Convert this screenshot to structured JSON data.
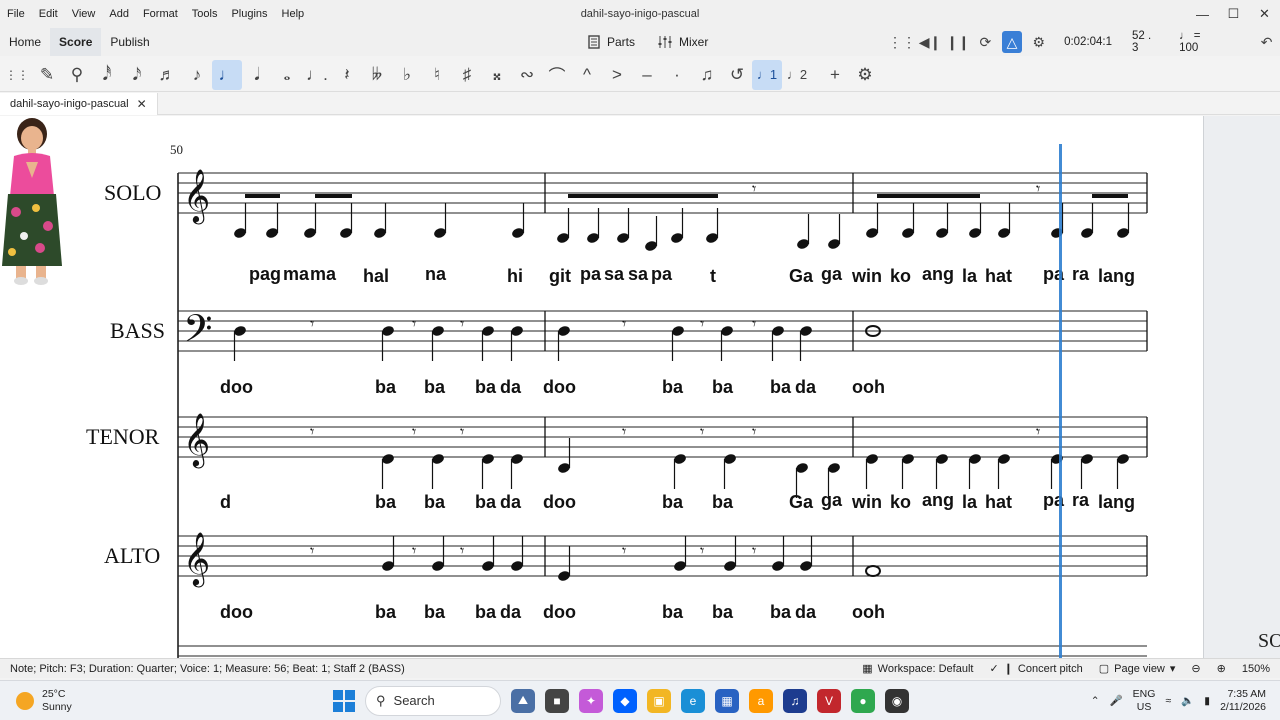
{
  "window": {
    "title": "dahil-sayo-inigo-pascual",
    "menu": [
      "File",
      "Edit",
      "View",
      "Add",
      "Format",
      "Tools",
      "Plugins",
      "Help"
    ]
  },
  "modes": {
    "tabs": [
      "Home",
      "Score",
      "Publish"
    ],
    "active": "Score",
    "parts_label": "Parts",
    "mixer_label": "Mixer",
    "time_readout": "0:02:04:1",
    "measure_beat": "52 . 3",
    "tempo_value": "= 100"
  },
  "note_toolbar": {
    "active": "quarter-note"
  },
  "document_tab": {
    "label": "dahil-sayo-inigo-pascual"
  },
  "score": {
    "measure_number": "50",
    "staves": [
      {
        "name": "SOLO",
        "lyrics": [
          "pag",
          "ma",
          "ma",
          "hal",
          "na",
          "hi",
          "git",
          "pa",
          "sa",
          "sa",
          "pa",
          "t",
          "Ga",
          "ga",
          "win",
          "ko",
          "ang",
          "la",
          "hat",
          "pa",
          "ra",
          "lang"
        ]
      },
      {
        "name": "BASS",
        "lyrics": [
          "doo",
          "ba",
          "ba",
          "ba",
          "da",
          "doo",
          "ba",
          "ba",
          "ba",
          "da",
          "ooh"
        ]
      },
      {
        "name": "TENOR",
        "lyrics": [
          "d",
          "ba",
          "ba",
          "ba",
          "da",
          "doo",
          "ba",
          "ba",
          "Ga",
          "ga",
          "win",
          "ko",
          "ang",
          "la",
          "hat",
          "pa",
          "ra",
          "lang"
        ]
      },
      {
        "name": "ALTO",
        "lyrics": [
          "doo",
          "ba",
          "ba",
          "ba",
          "da",
          "doo",
          "ba",
          "ba",
          "ba",
          "da",
          "ooh"
        ]
      }
    ],
    "edge_label": "SO"
  },
  "status": {
    "text": "Note; Pitch: F3; Duration: Quarter; Voice: 1; Measure: 56; Beat: 1; Staff 2 (BASS)",
    "workspace": "Workspace: Default",
    "concert_pitch": "Concert pitch",
    "page_view": "Page view",
    "zoom": "150%"
  },
  "taskbar": {
    "temperature": "25°C",
    "weather": "Sunny",
    "search_placeholder": "Search",
    "lang_line1": "ENG",
    "lang_line2": "US",
    "time": "7:35 AM",
    "date": "2/11/2026"
  }
}
